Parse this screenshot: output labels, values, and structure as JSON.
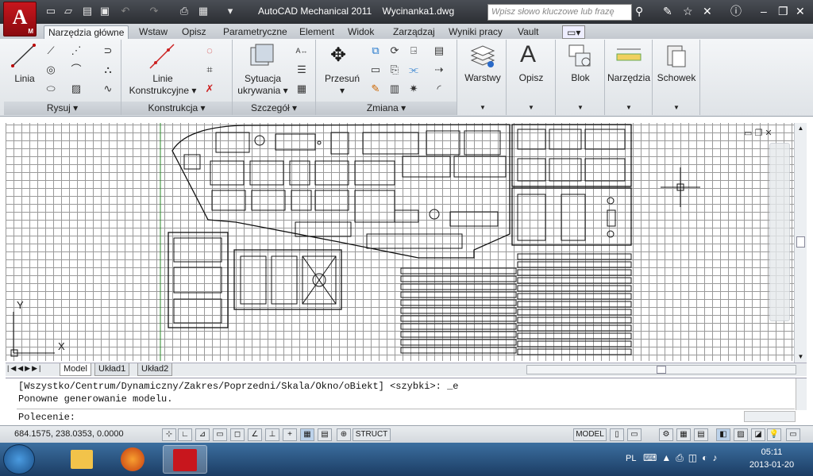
{
  "title": {
    "app": "AutoCAD Mechanical 2011",
    "file": "Wycinanka1.dwg",
    "search_placeholder": "Wpisz słowo kluczowe lub frazę"
  },
  "app_button": {
    "letter": "A",
    "sub": "M"
  },
  "tabs": [
    "Narzędzia główne",
    "Wstaw",
    "Opisz",
    "Parametryczne",
    "Element",
    "Widok",
    "Zarządzaj",
    "Wyniki pracy",
    "Vault"
  ],
  "ribbon": {
    "rysuj": {
      "linia": "Linia",
      "panel": "Rysuj"
    },
    "konstrukcja": {
      "linie1": "Linie",
      "linie2": "Konstrukcyjne",
      "panel": "Konstrukcja"
    },
    "szczegol": {
      "sytuacja1": "Sytuacja",
      "sytuacja2": "ukrywania",
      "panel": "Szczegół"
    },
    "zmiana": {
      "przesun": "Przesuń",
      "panel": "Zmiana"
    },
    "big": {
      "warstwy": "Warstwy",
      "opisz": "Opisz",
      "blok": "Blok",
      "narzedzia": "Narzędzia",
      "schowek": "Schowek"
    }
  },
  "axes": {
    "x": "X",
    "y": "Y"
  },
  "layout_tabs": [
    "Model",
    "Układ1",
    "Układ2"
  ],
  "command": {
    "line1": "[Wszystko/Centrum/Dynamiczny/Zakres/Poprzedni/Skala/Okno/oBiekt] <szybki>: _e",
    "line2": "Ponowne generowanie modelu.",
    "prompt": "Polecenie:"
  },
  "status": {
    "coords": "684.1575, 238.0353, 0.0000",
    "struct": "STRUCT",
    "model": "MODEL"
  },
  "tray": {
    "lang": "PL",
    "time": "05:11",
    "date": "2013-01-20"
  },
  "colors": {
    "accent_red": "#c8161d",
    "taskbar": "#2a5482"
  }
}
